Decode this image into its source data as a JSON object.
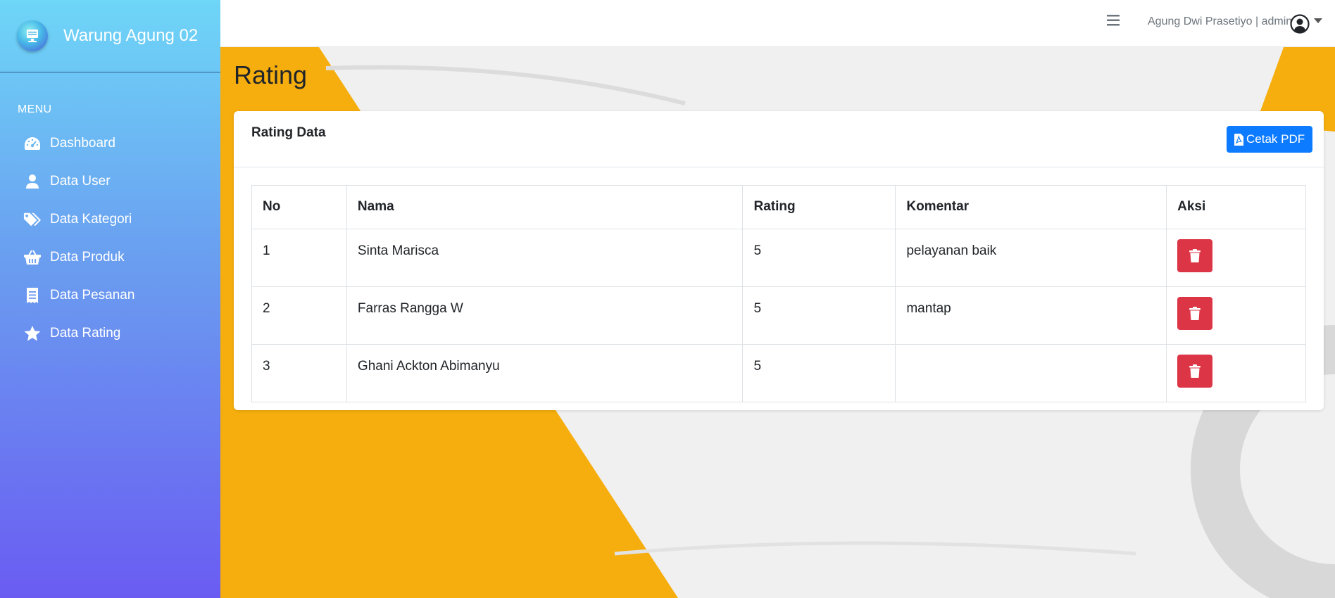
{
  "brand": {
    "name": "Warung Agung 02"
  },
  "sidebar": {
    "menu_title": "MENU",
    "items": [
      {
        "label": "Dashboard",
        "icon": "dashboard-gauge-icon"
      },
      {
        "label": "Data User",
        "icon": "user-icon"
      },
      {
        "label": "Data Kategori",
        "icon": "tags-icon"
      },
      {
        "label": "Data Produk",
        "icon": "basket-icon"
      },
      {
        "label": "Data Pesanan",
        "icon": "receipt-icon"
      },
      {
        "label": "Data Rating",
        "icon": "star-icon"
      }
    ]
  },
  "topbar": {
    "user": "Agung Dwi Prasetiyo | admin"
  },
  "page": {
    "title": "Rating"
  },
  "card": {
    "title": "Rating Data",
    "pdf_button": "Cetak PDF",
    "columns": [
      "No",
      "Nama",
      "Rating",
      "Komentar",
      "Aksi"
    ],
    "rows": [
      {
        "no": "1",
        "nama": "Sinta Marisca",
        "rating": "5",
        "komentar": "pelayanan baik"
      },
      {
        "no": "2",
        "nama": "Farras Rangga W",
        "rating": "5",
        "komentar": "mantap"
      },
      {
        "no": "3",
        "nama": "Ghani Ackton Abimanyu",
        "rating": "5",
        "komentar": ""
      }
    ]
  },
  "colors": {
    "primary": "#0d7bff",
    "danger": "#dc3545",
    "accent_orange": "#f6ae0e"
  }
}
